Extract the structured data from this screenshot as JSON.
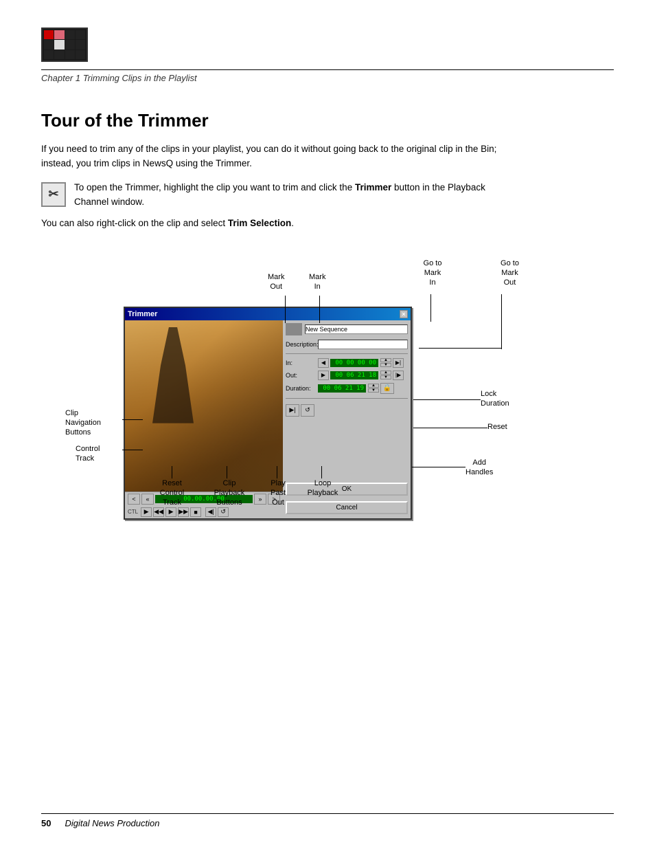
{
  "header": {
    "chapter_label": "Chapter 1    Trimming Clips in the Playlist"
  },
  "section": {
    "title": "Tour of the Trimmer",
    "body1": "If you need to trim any of the clips in your playlist, you can do it without going back to the original clip in the Bin; instead, you trim clips in NewsQ using the Trimmer.",
    "note_text": "To open the Trimmer, highlight the clip you want to trim and click the Trimmer button in the Playback Channel window.",
    "body2": "You can also right-click on the clip and select Trim Selection.",
    "trimmer_bold": "Trimmer",
    "trim_selection_bold": "Trim Selection"
  },
  "trimmer_window": {
    "title": "Trimmer",
    "close_btn": "×",
    "timecode": "00.00.00.00",
    "in_tc": "00 00 00 00",
    "out_tc": "00 06 21 18",
    "dur_tc": "00 06 21 19",
    "seq_label": "New Sequence",
    "desc_label": "Description:",
    "in_label": "In:",
    "out_label": "Out:",
    "duration_label": "Duration:",
    "ok_label": "OK",
    "cancel_label": "Cancel"
  },
  "annotations": {
    "mark_out": "Mark\nOut",
    "mark_in": "Mark\nIn",
    "go_to_mark_in": "Go to\nMark\nIn",
    "go_to_mark_out": "Go to\nMark\nOut",
    "lock_duration": "Lock\nDuration",
    "reset": "Reset",
    "clip_navigation": "Clip\nNavigation\nButtons",
    "control_track": "Control\nTrack",
    "reset_control_track": "Reset\nControl\nTrack",
    "clip_playback_buttons": "Clip\nPlayback\nButtons",
    "play_past_out": "Play\nPast\nOut",
    "loop_playback": "Loop\nPlayback",
    "add_handles": "Add\nHandles"
  },
  "footer": {
    "page": "50",
    "title": "Digital News Production"
  }
}
